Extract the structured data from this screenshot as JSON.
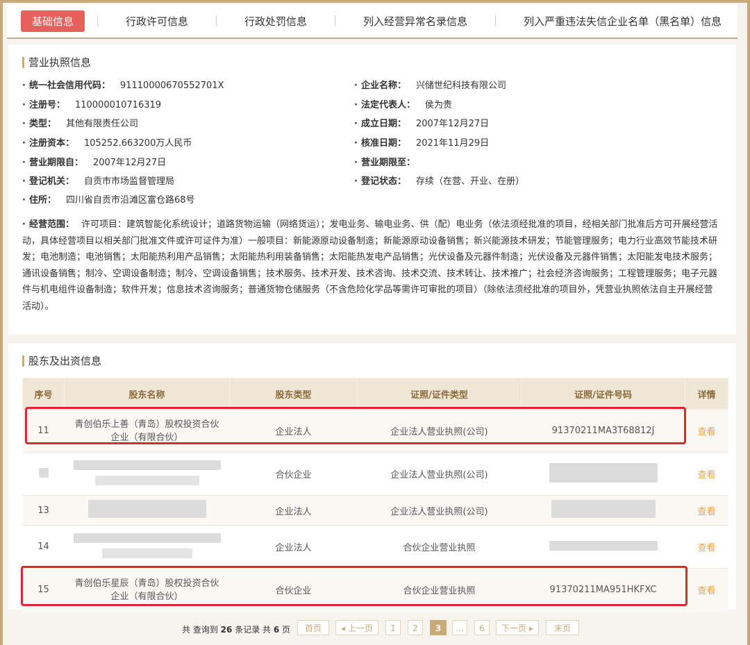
{
  "tabs": [
    {
      "label": "基础信息",
      "active": true
    },
    {
      "label": "行政许可信息"
    },
    {
      "label": "行政处罚信息"
    },
    {
      "label": "列入经营异常名录信息"
    },
    {
      "label": "列入严重违法失信企业名单（黑名单）信息"
    }
  ],
  "license": {
    "title": "营业执照信息",
    "fields": {
      "credit_code": {
        "label": "统一社会信用代码：",
        "value": "91110000670552701X"
      },
      "company_name": {
        "label": "企业名称：",
        "value": "兴储世纪科技有限公司"
      },
      "reg_no": {
        "label": "注册号：",
        "value": "110000010716319"
      },
      "legal_rep": {
        "label": "法定代表人：",
        "value": "侯为贵"
      },
      "type": {
        "label": "类型：",
        "value": "其他有限责任公司"
      },
      "established": {
        "label": "成立日期：",
        "value": "2007年12月27日"
      },
      "capital": {
        "label": "注册资本：",
        "value": "105252.663200万人民币"
      },
      "approved": {
        "label": "核准日期：",
        "value": "2021年11月29日"
      },
      "term_from": {
        "label": "营业期限自：",
        "value": "2007年12月27日"
      },
      "term_to": {
        "label": "营业期限至：",
        "value": ""
      },
      "authority": {
        "label": "登记机关：",
        "value": "自贡市市场监督管理局"
      },
      "status": {
        "label": "登记状态：",
        "value": "存续（在营、开业、在册）"
      },
      "address": {
        "label": "住所：",
        "value": "四川省自贡市沿滩区富仓路68号"
      }
    },
    "scope_label": "经营范围：",
    "scope_text": "许可项目：建筑智能化系统设计；道路货物运输（网络货运）；发电业务、输电业务、供（配）电业务（依法须经批准的项目，经相关部门批准后方可开展经营活动，具体经营项目以相关部门批准文件或许可证件为准）一般项目：新能源原动设备制造；新能源原动设备销售；新兴能源技术研发；节能管理服务；电力行业高效节能技术研发；电池制造；电池销售；太阳能热利用产品销售；太阳能热利用装备销售；太阳能热发电产品销售；光伏设备及元器件制造；光伏设备及元器件销售；太阳能发电技术服务；通讯设备销售；制冷、空调设备制造；制冷、空调设备销售；技术服务、技术开发、技术咨询、技术交流、技术转让、技术推广；社会经济咨询服务；工程管理服务；电子元器件与机电组件设备制造；软件开发；信息技术咨询服务；普通货物仓储服务（不含危险化学品等需许可审批的项目）（除依法须经批准的项目外，凭营业执照依法自主开展经营活动）。"
  },
  "shareholders": {
    "title": "股东及出资信息",
    "headers": [
      "序号",
      "股东名称",
      "股东类型",
      "证照/证件类型",
      "证照/证件号码",
      "详情"
    ],
    "rows": [
      {
        "no": "11",
        "name_line1": "青创伯乐上善（青岛）股权投资合伙",
        "name_line2": "企业（有限合伙）",
        "type": "企业法人",
        "cert_type": "企业法人营业执照(公司)",
        "cert_no": "91370211MA3T68812J",
        "detail": "查看"
      },
      {
        "no": "",
        "name_line1": "",
        "name_line2": "",
        "type": "合伙企业",
        "cert_type": "企业法人营业执照(公司)",
        "cert_no": "",
        "detail": "查看"
      },
      {
        "no": "13",
        "name_line1": "",
        "name_line2": "",
        "type": "企业法人",
        "cert_type": "企业法人营业执照(公司)",
        "cert_no": "",
        "detail": "查看"
      },
      {
        "no": "14",
        "name_line1": "",
        "name_line2": "",
        "type": "企业法人",
        "cert_type": "合伙企业营业执照",
        "cert_no": "",
        "detail": "查看"
      },
      {
        "no": "15",
        "name_line1": "青创伯乐星辰（青岛）股权投资合伙",
        "name_line2": "企业（有限合伙）",
        "type": "合伙企业",
        "cert_type": "合伙企业营业执照",
        "cert_no": "91370211MA951HKFXC",
        "detail": "查看"
      }
    ]
  },
  "pagination": {
    "prefix": "共 查询到",
    "total": "26",
    "mid": "条记录 共",
    "pages": "6",
    "suffix": "页",
    "first": "首页",
    "prev": "◂ 上一页",
    "p1": "1",
    "p2": "2",
    "p3": "3",
    "ellipsis": "...",
    "p6": "6",
    "next": "下一页 ▸",
    "last": "末页"
  },
  "colors": {
    "accent": "#c8a978",
    "active_tab": "#e8605b",
    "highlight": "#e0282c",
    "link": "#e8a34a"
  }
}
